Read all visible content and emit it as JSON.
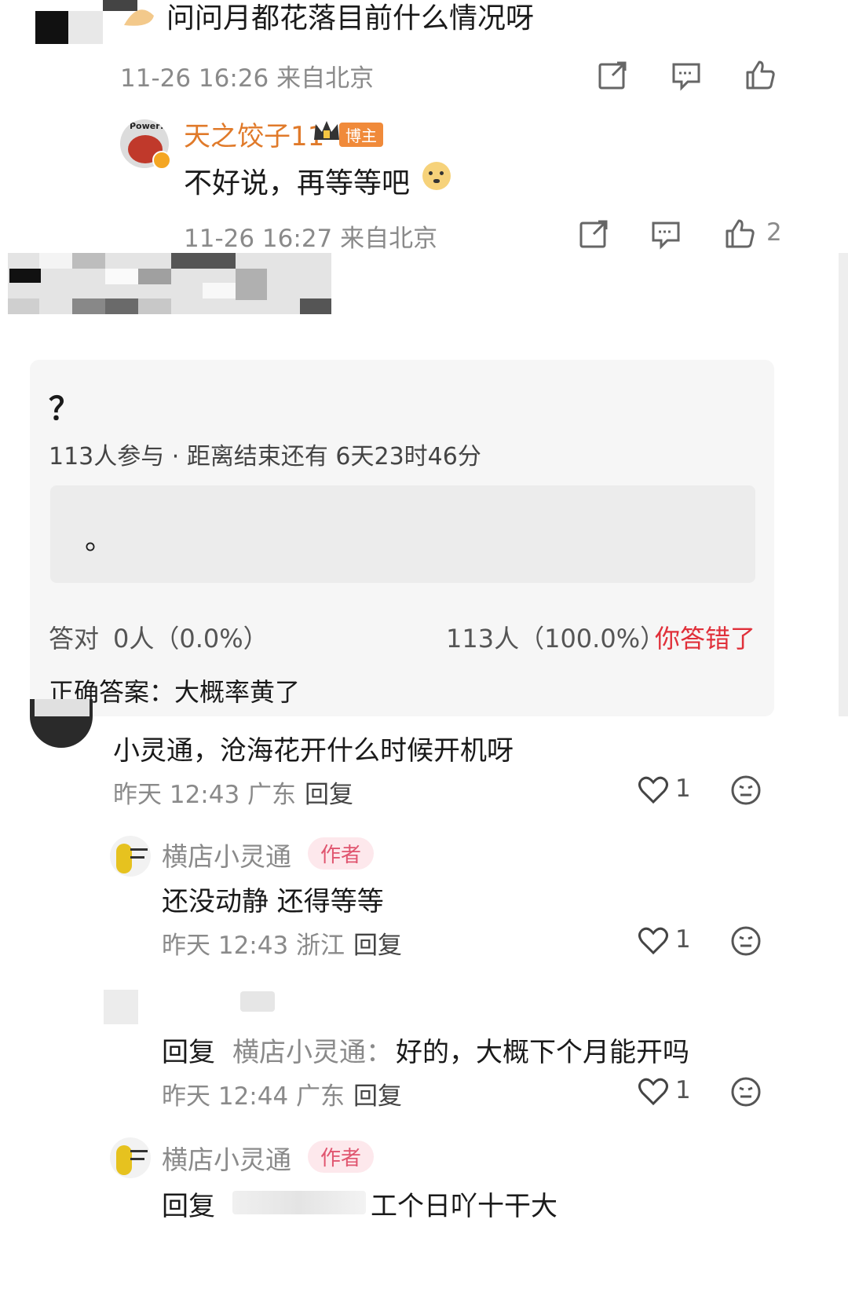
{
  "weibo": {
    "question": {
      "text": "问问月都花落目前什么情况呀",
      "meta": "11-26 16:26 来自北京"
    },
    "answer": {
      "name": "天之饺子11",
      "badge": "博主",
      "avatar_text": "Power!",
      "text": "不好说，再等等吧",
      "meta": "11-26 16:27 来自北京",
      "like_count": "2"
    }
  },
  "quiz": {
    "title": "？",
    "stats": "113人参与 · 距离结束还有 6天23时46分",
    "option": "。",
    "correct_label": "答对",
    "correct_stats": "0人（0.0%）",
    "wrong_stats": "113人（100.0%）",
    "wrong_label": "你答错了",
    "answer_line": "正确答案：大概率黄了"
  },
  "comments": [
    {
      "text": "小灵通，沧海花开什么时候开机呀",
      "time": "昨天 12:43 广东",
      "reply_label": "回复",
      "likes": "1"
    },
    {
      "name": "横店小灵通",
      "tag": "作者",
      "text": "还没动静 还得等等",
      "time": "昨天 12:43 浙江",
      "reply_label": "回复",
      "likes": "1"
    },
    {
      "prefix": "回复",
      "target": "横店小灵通：",
      "text": "好的，大概下个月能开吗",
      "time": "昨天 12:44 广东",
      "reply_label": "回复",
      "likes": "1"
    },
    {
      "name": "横店小灵通",
      "tag": "作者",
      "prefix": "回复",
      "text": "工个日吖十干大"
    }
  ],
  "colors": {
    "name_orange": "#e07a2a",
    "author_tag": "#e0556f",
    "wrong_red": "#e0303a",
    "meta_gray": "#8a8a8a"
  }
}
